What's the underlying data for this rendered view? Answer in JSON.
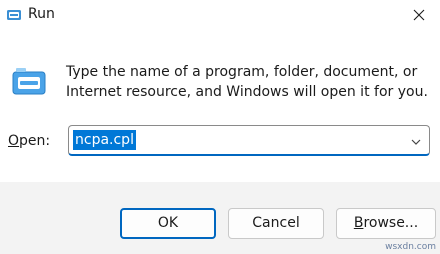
{
  "window": {
    "title": "Run",
    "title_icon": "run-icon",
    "close_icon": "close-icon"
  },
  "body": {
    "icon": "run-icon",
    "description_line1": "Type the name of a program, folder, document, or",
    "description_line2": "Internet resource, and Windows will open it for you.",
    "open_label_prefix": "O",
    "open_label_rest": "pen:",
    "input_value": "ncpa.cpl",
    "dropdown_icon": "chevron-down-icon"
  },
  "buttons": {
    "ok": "OK",
    "cancel": "Cancel",
    "browse_prefix": "B",
    "browse_rest": "rowse..."
  },
  "watermark": "wsxdn.com",
  "colors": {
    "accent": "#0067c0",
    "selection": "#0078d7",
    "footer_bg": "#f3f3f3"
  }
}
